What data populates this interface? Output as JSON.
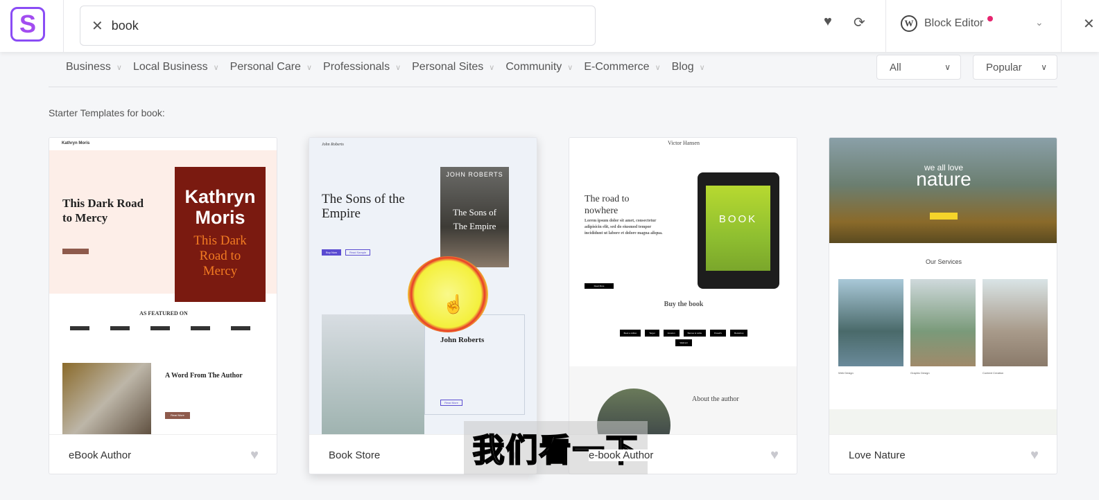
{
  "header": {
    "logo": "S",
    "search_value": "book",
    "editor_label": "Block Editor",
    "icons": [
      "close-icon",
      "heart-icon",
      "refresh-icon",
      "wordpress-icon",
      "chevron-down-icon"
    ]
  },
  "categories": [
    "Business",
    "Local Business",
    "Personal Care",
    "Professionals",
    "Personal Sites",
    "Community",
    "E-Commerce",
    "Blog"
  ],
  "filters": {
    "type": "All",
    "sort": "Popular"
  },
  "results_label": "Starter Templates for book:",
  "cards": [
    {
      "name": "eBook Author",
      "preview": {
        "site": "Kathryn Moris",
        "title": "This Dark Road to Mercy",
        "cover_author": "Kathryn Moris",
        "cover_title": "This Dark Road to Mercy",
        "featured": "AS FEATURED ON",
        "section": "A Word From The Author",
        "button": "Read More"
      }
    },
    {
      "name": "Book Store",
      "preview": {
        "site": "John Roberts",
        "title": "The Sons of the Empire",
        "cover_author": "JOHN ROBERTS",
        "cover_title": "The Sons of The Empire",
        "buy": "Buy Now",
        "sample": "Read Sample",
        "bio_name": "John Roberts",
        "button": "Read More"
      }
    },
    {
      "name": "e-book Author",
      "preview": {
        "site": "Victor Hansen",
        "title": "The road to nowhere",
        "lead": "Lorem ipsum dolor sit amet, consectetur adipisicin elit, sed do eiusmod tempor incididunt ut labore et dolore magna aliqua.",
        "cover": "BOOK",
        "button": "Read More",
        "section": "Buy the book",
        "stores": [
          "Book a million",
          "Target",
          "Amazon",
          "Barnes & noble",
          "Powell's",
          "Bookshop",
          "Walmart"
        ],
        "about": "About the author"
      }
    },
    {
      "name": "Love Nature",
      "preview": {
        "hero_small": "we all love",
        "hero_big": "nature",
        "section": "Our Services",
        "services": [
          "Web Design",
          "Graphic Design",
          "Content Creation"
        ]
      }
    }
  ],
  "subtitle": "我们看一下",
  "colors": {
    "accent": "#8a4cf5",
    "editor_dot": "#e6256f"
  }
}
